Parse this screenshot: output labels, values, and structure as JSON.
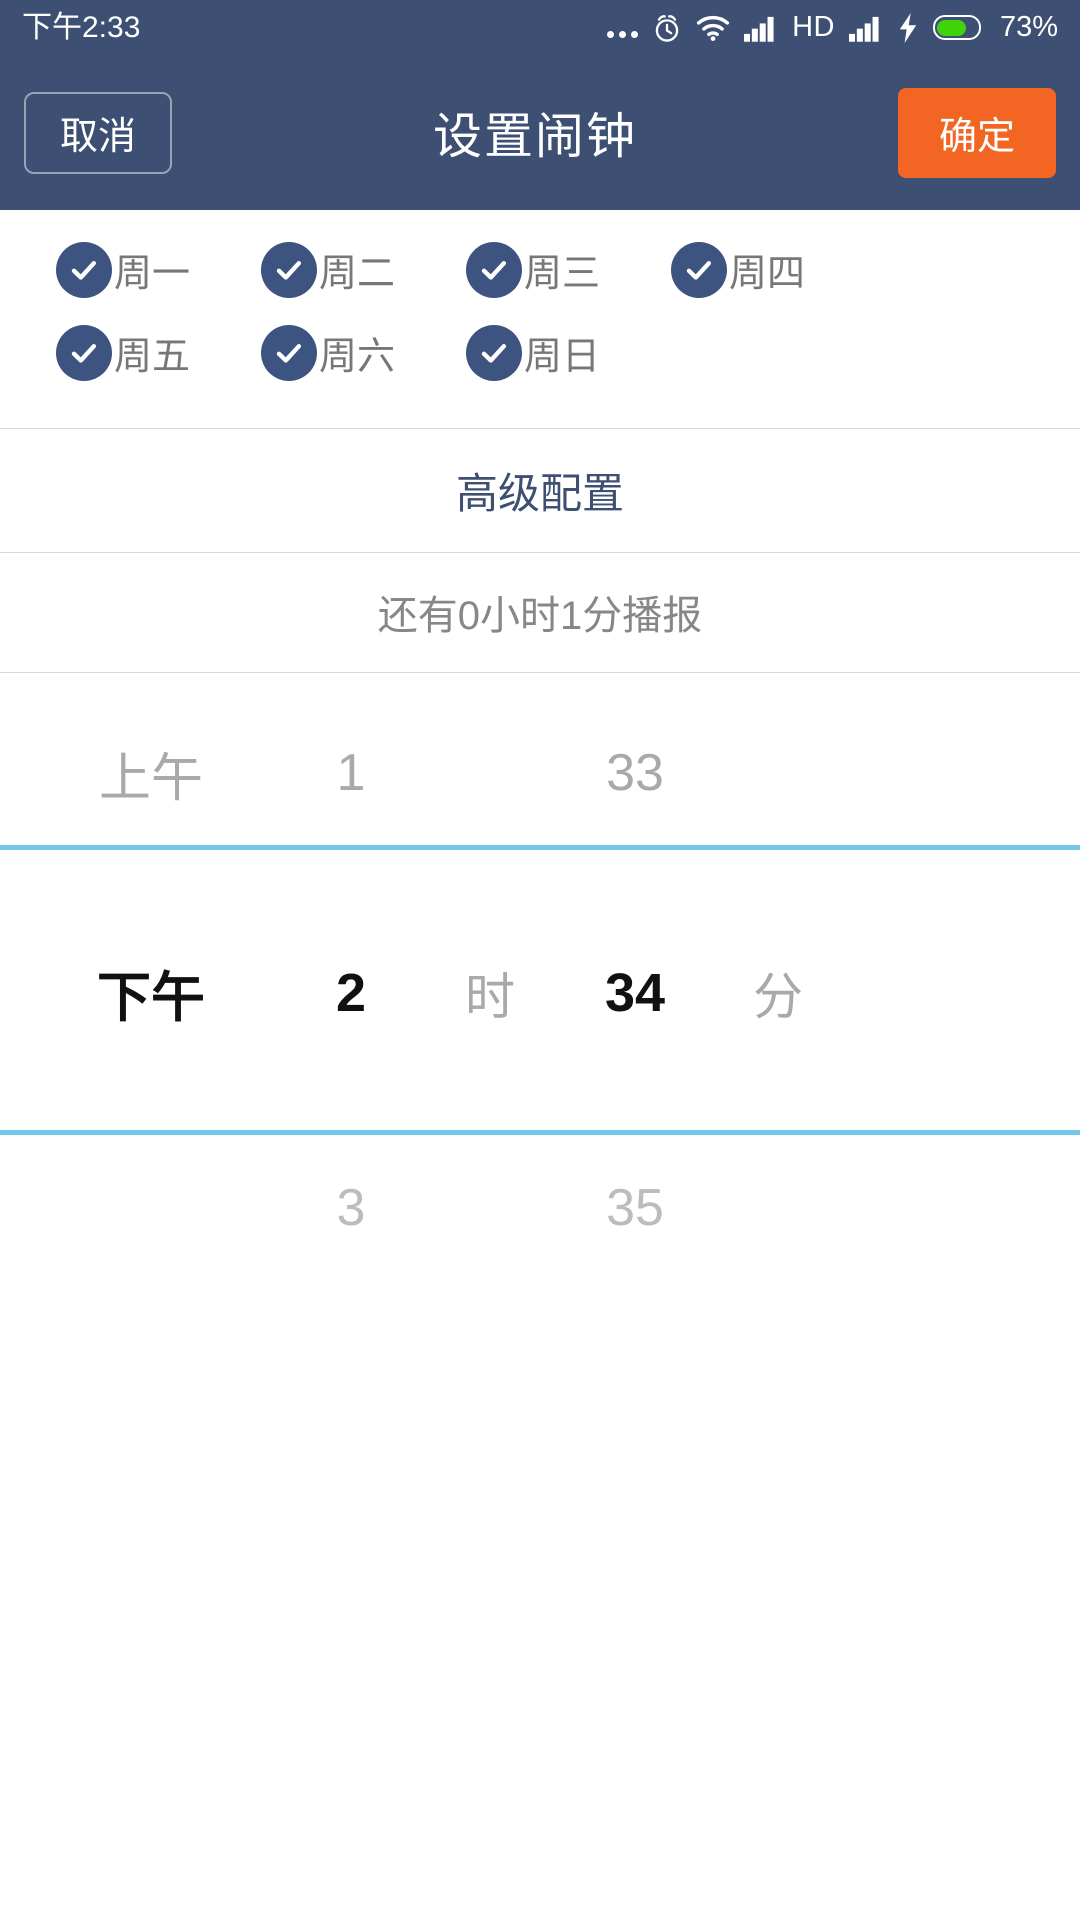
{
  "status_bar": {
    "time": "下午2:33",
    "battery_percent": "73%",
    "battery_level": 73,
    "hd_label": "HD",
    "icons": [
      "more-dots-icon",
      "alarm-clock-icon",
      "wifi-icon",
      "signal-bars-icon",
      "hd-icon",
      "signal-bars-icon",
      "charging-bolt-icon",
      "battery-icon"
    ],
    "bg_color": "#3d4f72",
    "battery_color": "#3fd40a"
  },
  "header": {
    "cancel_label": "取消",
    "title": "设置闹钟",
    "confirm_label": "确定",
    "bg_color": "#3d4f72",
    "confirm_color": "#f26522"
  },
  "weekdays": {
    "rows": [
      [
        {
          "label": "周一",
          "checked": true
        },
        {
          "label": "周二",
          "checked": true
        },
        {
          "label": "周三",
          "checked": true
        },
        {
          "label": "周四",
          "checked": true
        }
      ],
      [
        {
          "label": "周五",
          "checked": true
        },
        {
          "label": "周六",
          "checked": true
        },
        {
          "label": "周日",
          "checked": true
        }
      ]
    ],
    "check_color": "#3d5480"
  },
  "advanced": {
    "label": "高级配置",
    "color": "#3d4f72"
  },
  "countdown": {
    "text": "还有0小时1分播报",
    "color": "#878787"
  },
  "time_picker": {
    "highlight_color": "#73c7ea",
    "hour_unit": "时",
    "minute_unit": "分",
    "rows": {
      "above": {
        "ampm": "上午",
        "hour": "1",
        "minute": "33"
      },
      "selected": {
        "ampm": "下午",
        "hour": "2",
        "minute": "34"
      },
      "below": {
        "ampm": "",
        "hour": "3",
        "minute": "35"
      }
    }
  }
}
